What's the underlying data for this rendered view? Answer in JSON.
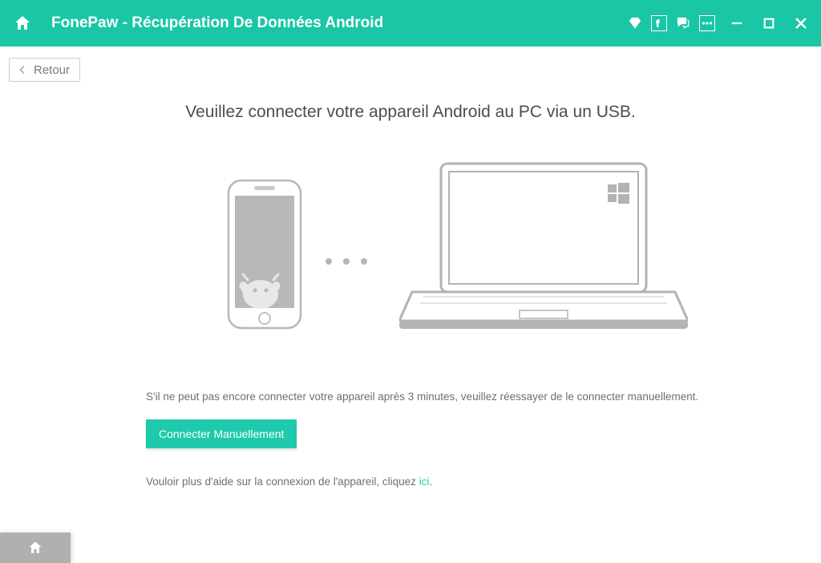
{
  "titlebar": {
    "app_title": "FonePaw - Récupération De Données Android"
  },
  "back_button": "Retour",
  "heading": "Veuillez connecter votre appareil Android au PC via un USB.",
  "note": "S'il ne peut pas encore connecter votre appareil après 3 minutes, veuillez réessayer de le connecter manuellement.",
  "connect_button": "Connecter Manuellement",
  "help": {
    "prefix": "Vouloir plus d'aide sur la connexion de l'appareil, cliquez ",
    "link": "ici"
  }
}
